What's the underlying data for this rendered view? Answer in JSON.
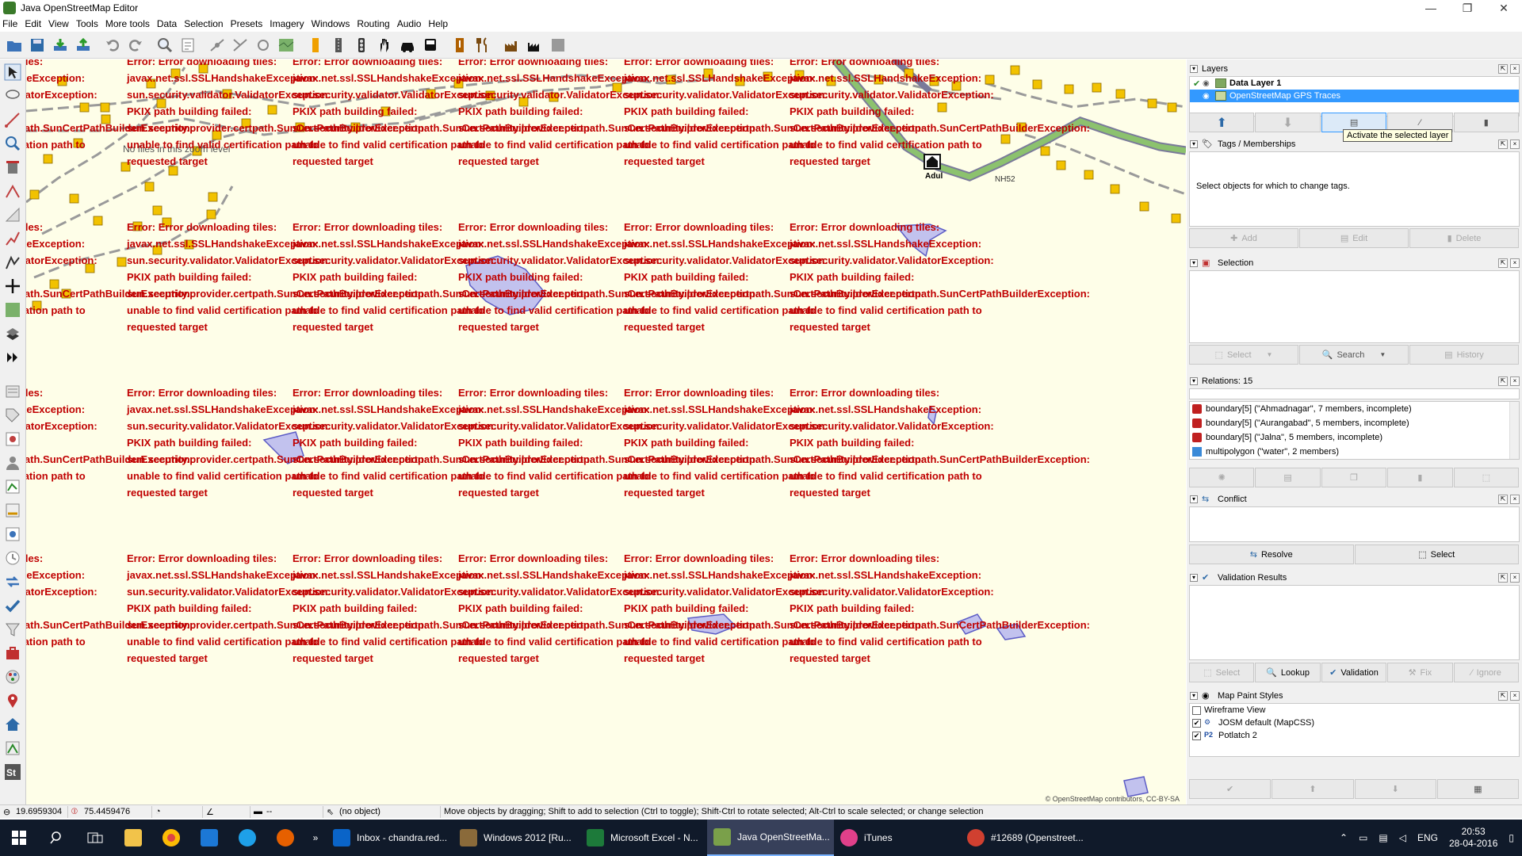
{
  "window": {
    "title": "Java OpenStreetMap Editor",
    "controls": [
      "—",
      "❐",
      "✕"
    ]
  },
  "menu": [
    "File",
    "Edit",
    "View",
    "Tools",
    "More tools",
    "Data",
    "Selection",
    "Presets",
    "Imagery",
    "Windows",
    "Routing",
    "Audio",
    "Help"
  ],
  "map": {
    "error_lines": [
      "Error: Error downloading tiles:",
      "javax.net.ssl.SSLHandshakeException:",
      "sun.security.validator.ValidatorException:",
      "PKIX path building failed:",
      "sun.security.provider.certpath.SunCertPathBuilderException:",
      "unable to find valid certification path to",
      "requested target"
    ],
    "hint": "No files in this zoom level",
    "place_label": "Adul",
    "road_label": "NH52",
    "attribution": "© OpenStreetMap contributors, CC-BY-SA"
  },
  "layers": {
    "title": "Layers",
    "items": [
      {
        "name": "Data Layer 1",
        "selected": false,
        "active": true
      },
      {
        "name": "OpenStreetMap GPS Traces",
        "selected": true,
        "active": false
      }
    ],
    "tooltip": "Activate the selected layer"
  },
  "tags": {
    "title": "Tags / Memberships",
    "empty_text": "Select objects for which to change tags.",
    "buttons": [
      "Add",
      "Edit",
      "Delete"
    ]
  },
  "selection": {
    "title": "Selection",
    "buttons": [
      "Select",
      "Search",
      "History"
    ]
  },
  "relations": {
    "title": "Relations: 15",
    "items": [
      {
        "text": "boundary[5] (\"Ahmadnagar\", 7 members, incomplete)",
        "kind": "boundary"
      },
      {
        "text": "boundary[5] (\"Aurangabad\", 5 members, incomplete)",
        "kind": "boundary"
      },
      {
        "text": "boundary[5] (\"Jalna\", 5 members, incomplete)",
        "kind": "boundary"
      },
      {
        "text": "multipolygon (\"water\", 2 members)",
        "kind": "multipolygon"
      }
    ]
  },
  "conflict": {
    "title": "Conflict",
    "buttons": [
      "Resolve",
      "Select"
    ]
  },
  "validation": {
    "title": "Validation Results",
    "buttons": [
      "Select",
      "Lookup",
      "Validation",
      "Fix",
      "Ignore"
    ]
  },
  "mapstyles": {
    "title": "Map Paint Styles",
    "items": [
      {
        "name": "Wireframe View",
        "checked": false,
        "icon": ""
      },
      {
        "name": "JOSM default (MapCSS)",
        "checked": true,
        "icon": "josm"
      },
      {
        "name": "Potlatch 2",
        "checked": true,
        "icon": "P2"
      }
    ]
  },
  "status": {
    "lat": "19.6959304",
    "lon": "75.4459476",
    "heading": "",
    "angle": "",
    "distance": "--",
    "object": "(no object)",
    "help": "Move objects by dragging; Shift to add to selection (Ctrl to toggle); Shift-Ctrl to rotate selected; Alt-Ctrl to scale selected; or change selection"
  },
  "taskbar": {
    "apps": [
      {
        "label": "Inbox - chandra.red...",
        "color": "#0a64c8",
        "active": false
      },
      {
        "label": "Windows 2012 [Ru...",
        "color": "#8a6a3a",
        "active": false
      },
      {
        "label": "Microsoft Excel - N...",
        "color": "#1d7a3a",
        "active": false
      },
      {
        "label": "Java OpenStreetMa...",
        "color": "#7aa04a",
        "active": true
      },
      {
        "label": "iTunes",
        "color": "#e0408a",
        "active": false
      },
      {
        "label": "#12689 (Openstreet...",
        "color": "#d04030",
        "active": false
      }
    ],
    "language": "ENG",
    "time": "20:53",
    "date": "28-04-2016"
  }
}
